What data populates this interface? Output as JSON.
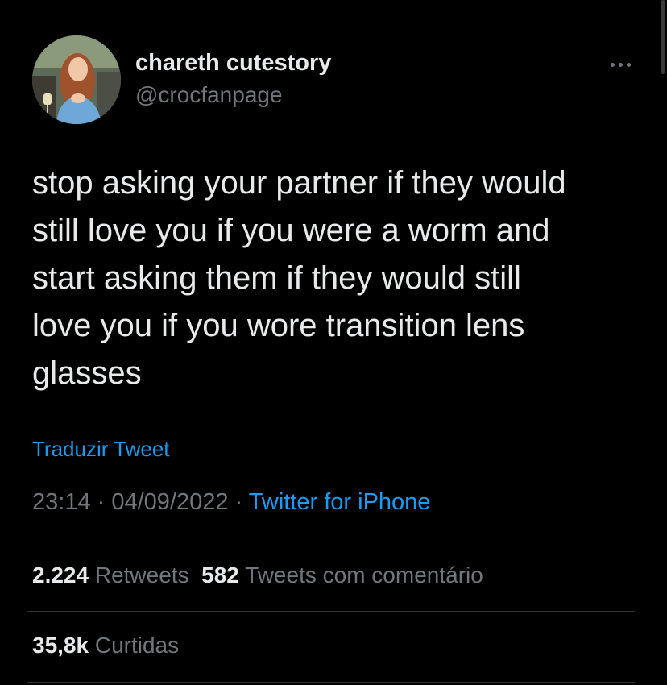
{
  "user": {
    "display_name": "chareth cutestory",
    "handle": "@crocfanpage"
  },
  "tweet": {
    "lines": [
      "stop asking your partner if they would",
      "still love you if you were a worm and",
      "start asking them if they would still",
      "love you if you wore transition lens",
      "glasses"
    ],
    "translate_label": "Traduzir Tweet",
    "time": "23:14",
    "date": "04/09/2022",
    "separator": " · ",
    "source": "Twitter for iPhone"
  },
  "stats": {
    "retweets_count": "2.224",
    "retweets_label": "Retweets",
    "quotes_count": "582",
    "quotes_label": "Tweets com comentário",
    "likes_count": "35,8k",
    "likes_label": "Curtidas"
  },
  "icons": {
    "more": "more-horizontal-icon"
  },
  "colors": {
    "background": "#000000",
    "text_primary": "#e7e9ea",
    "text_secondary": "#71767b",
    "link": "#1d9bf0",
    "divider": "#2f3336"
  }
}
